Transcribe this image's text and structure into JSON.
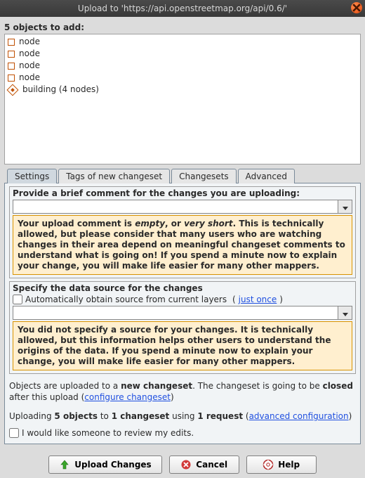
{
  "window": {
    "title": "Upload to 'https://api.openstreetmap.org/api/0.6/'"
  },
  "objects": {
    "heading": "5 objects to add:",
    "items": [
      {
        "icon": "node",
        "label": "node"
      },
      {
        "icon": "node",
        "label": "node"
      },
      {
        "icon": "node",
        "label": "node"
      },
      {
        "icon": "node",
        "label": "node"
      },
      {
        "icon": "way",
        "label": "building (4 nodes)"
      }
    ]
  },
  "tabs": [
    {
      "label": "Settings",
      "active": true
    },
    {
      "label": "Tags of new changeset",
      "active": false
    },
    {
      "label": "Changesets",
      "active": false
    },
    {
      "label": "Advanced",
      "active": false
    }
  ],
  "comment": {
    "label": "Provide a brief comment for the changes you are uploading:",
    "value": "",
    "warning_html": "Your upload comment is <em>empty</em>, or <em>very short</em>. This is technically allowed, but please consider that many users who are watching changes in their area depend on meaningful changeset comments to understand what is going on! If you spend a minute now to explain your change, you will make life easier for many other mappers."
  },
  "source": {
    "label": "Specify the data source for the changes",
    "auto_label": "Automatically obtain source from current layers",
    "just_once": "just once",
    "value": "",
    "warning_html": "You did not specify a source for your changes. It is technically allowed, but this information helps other users to understand the origins of the data. If you spend a minute now to explain your change, you will make life easier for many other mappers."
  },
  "info": {
    "line1_pre": "Objects are uploaded to a ",
    "line1_bold": "new changeset",
    "line1_mid": ". The changeset is going to be ",
    "line1_bold2": "closed",
    "line1_post": " after this upload (",
    "configure": "configure changeset",
    "line1_end": ")",
    "line2_a": "Uploading ",
    "line2_b": "5 objects",
    "line2_c": " to ",
    "line2_d": "1 changeset",
    "line2_e": " using ",
    "line2_f": "1 request",
    "line2_g": " (",
    "adv": "advanced configuration",
    "line2_h": ")",
    "review": "I would like someone to review my edits."
  },
  "buttons": {
    "upload": "Upload Changes",
    "cancel": "Cancel",
    "help": "Help"
  }
}
